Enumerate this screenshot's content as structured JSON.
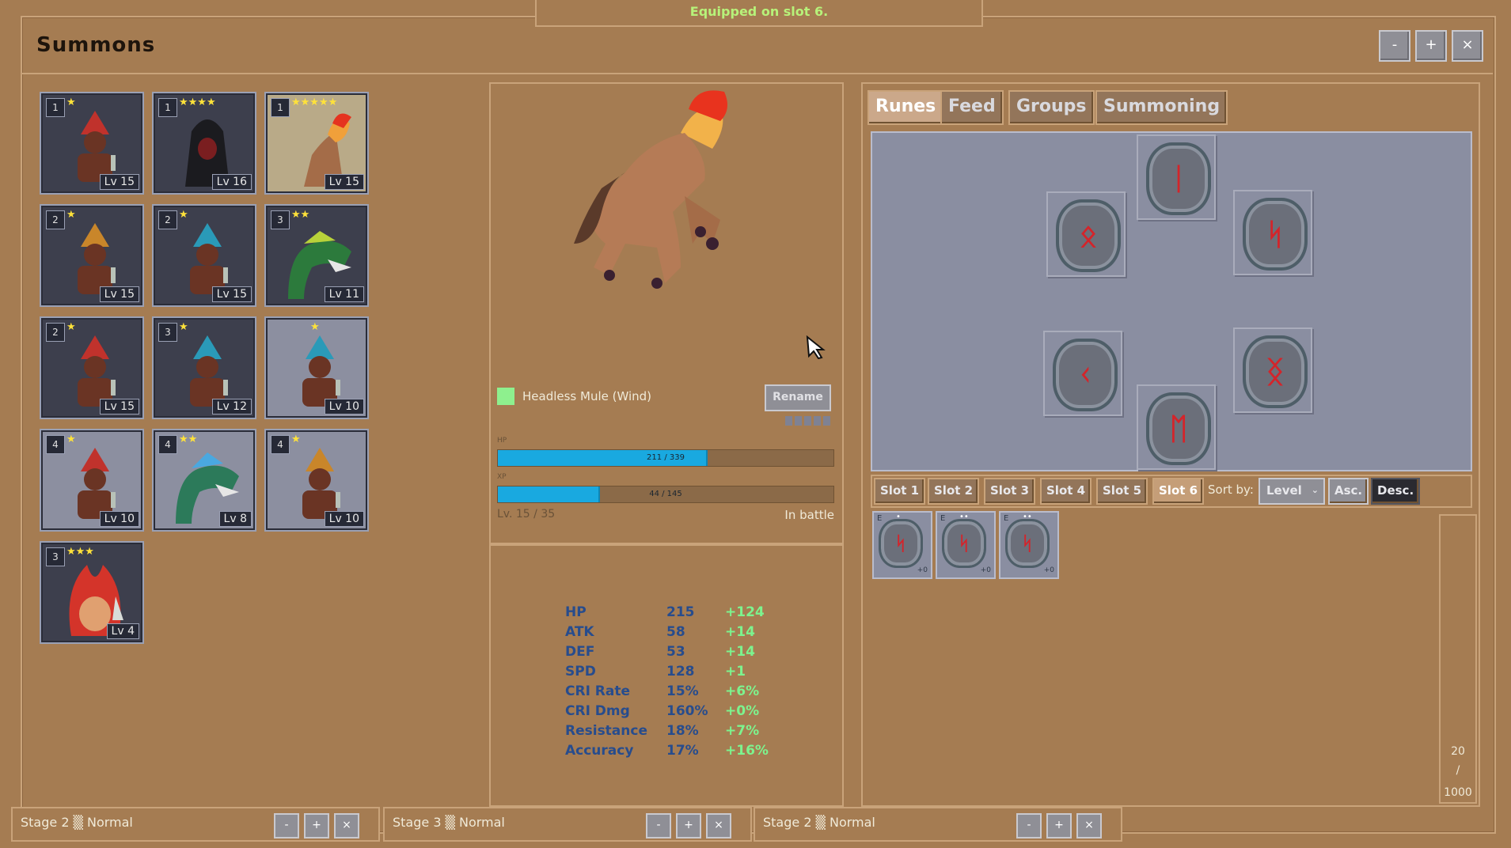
{
  "notice": "Equipped on slot 6.",
  "window": {
    "title": "Summons",
    "buttons": [
      "-",
      "+",
      "×"
    ]
  },
  "roster": [
    {
      "group": "1",
      "stars": "★",
      "level": "Lv 15",
      "variant": "red-hat"
    },
    {
      "group": "1",
      "stars": "★★★★",
      "level": "Lv 16",
      "variant": "hooded"
    },
    {
      "group": "1",
      "stars": "★★★★★",
      "level": "Lv 15",
      "variant": "mule"
    },
    {
      "group": "2",
      "stars": "★",
      "level": "Lv 15",
      "variant": "orange-hat"
    },
    {
      "group": "2",
      "stars": "★",
      "level": "Lv 15",
      "variant": "blue-hat"
    },
    {
      "group": "3",
      "stars": "★★",
      "level": "Lv 11",
      "variant": "green-dragon"
    },
    {
      "group": "2",
      "stars": "★",
      "level": "Lv 15",
      "variant": "red-hat"
    },
    {
      "group": "3",
      "stars": "★",
      "level": "Lv 12",
      "variant": "blue-hat"
    },
    {
      "group": "",
      "stars": "★",
      "level": "Lv 10",
      "variant": "blue-hat"
    },
    {
      "group": "4",
      "stars": "★",
      "level": "Lv 10",
      "variant": "red-hat"
    },
    {
      "group": "4",
      "stars": "★★",
      "level": "Lv 8",
      "variant": "blue-dragon"
    },
    {
      "group": "4",
      "stars": "★",
      "level": "Lv 10",
      "variant": "orange-hat"
    },
    {
      "group": "3",
      "stars": "★★★",
      "level": "Lv 4",
      "variant": "fire"
    }
  ],
  "detail": {
    "name": "Headless Mule (Wind)",
    "element_color": "#8ef08e",
    "rename_label": "Rename",
    "hp_label": "HP",
    "hp_text": "211 / 339",
    "hp_fraction": 0.62,
    "xp_label": "XP",
    "xp_text": "44 / 145",
    "xp_fraction": 0.3,
    "level_text": "Lv. 15 / 35",
    "status": "In battle"
  },
  "stats": [
    {
      "name": "HP",
      "value": "215",
      "bonus": "+124"
    },
    {
      "name": "ATK",
      "value": "58",
      "bonus": "+14"
    },
    {
      "name": "DEF",
      "value": "53",
      "bonus": "+14"
    },
    {
      "name": "SPD",
      "value": "128",
      "bonus": "+1"
    },
    {
      "name": "CRI Rate",
      "value": "15%",
      "bonus": "+6%"
    },
    {
      "name": "CRI Dmg",
      "value": "160%",
      "bonus": "+0%"
    },
    {
      "name": "Resistance",
      "value": "18%",
      "bonus": "+7%"
    },
    {
      "name": "Accuracy",
      "value": "17%",
      "bonus": "+16%"
    }
  ],
  "tabs": [
    "Runes",
    "Feed",
    "Groups",
    "Summoning"
  ],
  "active_tab": "Runes",
  "slots": [
    "Slot 1",
    "Slot 2",
    "Slot 3",
    "Slot 4",
    "Slot 5",
    "Slot 6"
  ],
  "active_slot": "Slot 6",
  "sort": {
    "label": "Sort by:",
    "selected": "Level",
    "asc_label": "Asc.",
    "desc_label": "Desc."
  },
  "inventory": [
    {
      "equip": "E",
      "plus": "+0",
      "dots": "•"
    },
    {
      "equip": "E",
      "plus": "+0",
      "dots": "••"
    },
    {
      "equip": "E",
      "plus": "+0",
      "dots": "••"
    }
  ],
  "capacity": {
    "current": "20",
    "sep": "/",
    "max": "1000"
  },
  "stages": [
    {
      "label": "Stage 2 ▒ Normal"
    },
    {
      "label": "Stage 3 ▒ Normal"
    },
    {
      "label": "Stage 2 ▒ Normal"
    }
  ]
}
